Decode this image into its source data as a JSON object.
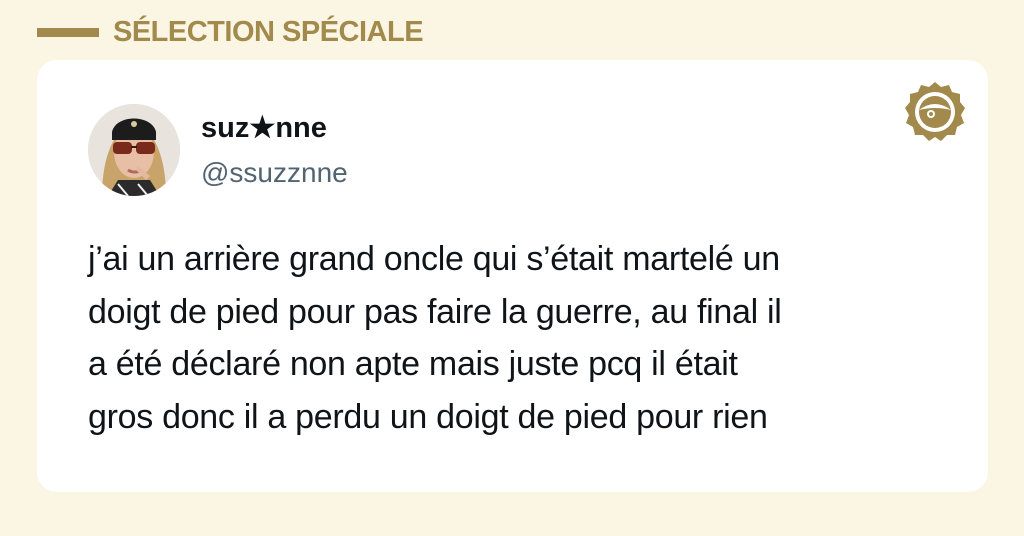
{
  "section": {
    "title": "SÉLECTION SPÉCIALE"
  },
  "tweet": {
    "author": {
      "name": "suz★nne",
      "handle": "@ssuzznne"
    },
    "lines": [
      "j’ai un arrière grand oncle qui s’était martelé un",
      "doigt de pied pour pas faire la guerre, au final il",
      "a été déclaré non apte mais juste pcq il était",
      "gros donc il a perdu un doigt de pied pour rien"
    ]
  },
  "icons": {
    "section_bar": "section-bar",
    "brand": "brand-badge-icon",
    "avatar": "profile-photo"
  },
  "colors": {
    "background": "#fbf5e4",
    "accent_gold": "#a28a4c",
    "card": "#ffffff",
    "text_primary": "#0f1419",
    "text_secondary": "#536471"
  }
}
